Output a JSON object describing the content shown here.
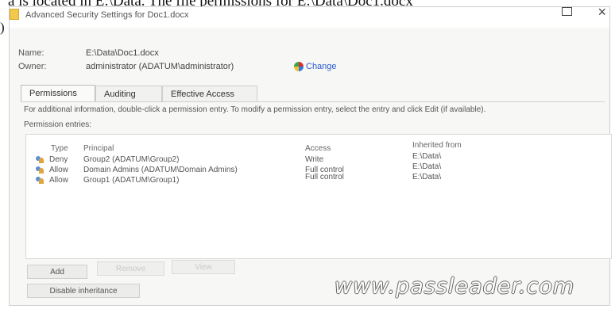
{
  "top_text": "a is located in E:\\Data. The file permissions for E:\\Data\\Doc1.docx",
  "left_paren": ")",
  "window": {
    "title": "Advanced Security Settings for Doc1.docx",
    "maximize_glyph": "",
    "close_glyph": "×"
  },
  "fields": {
    "name_label": "Name:",
    "name_value": "E:\\Data\\Doc1.docx",
    "owner_label": "Owner:",
    "owner_value": "administrator (ADATUM\\administrator)",
    "change_label": "Change"
  },
  "tabs": [
    {
      "label": "Permissions",
      "active": true
    },
    {
      "label": "Auditing",
      "active": false
    },
    {
      "label": "Effective Access",
      "active": false
    }
  ],
  "info_text": "For additional information, double-click a permission entry. To modify a permission entry, select the entry and click Edit (if available).",
  "entries_label": "Permission entries:",
  "table": {
    "headers": [
      "Type",
      "Principal",
      "Access",
      "Inherited from"
    ],
    "rows": [
      {
        "type": "Deny",
        "principal": "Group2 (ADATUM\\Group2)",
        "access": "Write",
        "inherited": "E:\\Data\\"
      },
      {
        "type": "Allow",
        "principal": "Domain Admins (ADATUM\\Domain Admins)",
        "access": "Full control",
        "inherited": "E:\\Data\\"
      },
      {
        "type": "Allow",
        "principal": "Group1 (ADATUM\\Group1)",
        "access": "Full control",
        "inherited": "E:\\Data\\"
      }
    ]
  },
  "buttons": {
    "add": "Add",
    "remove": "Remove",
    "view": "View",
    "disable_inheritance": "Disable inheritance"
  },
  "watermark": "www.passleader.com",
  "colors": {
    "link": "#2a5bd0",
    "window_bg": "#f7f7f5",
    "folder_icon": "#f2c94c"
  }
}
